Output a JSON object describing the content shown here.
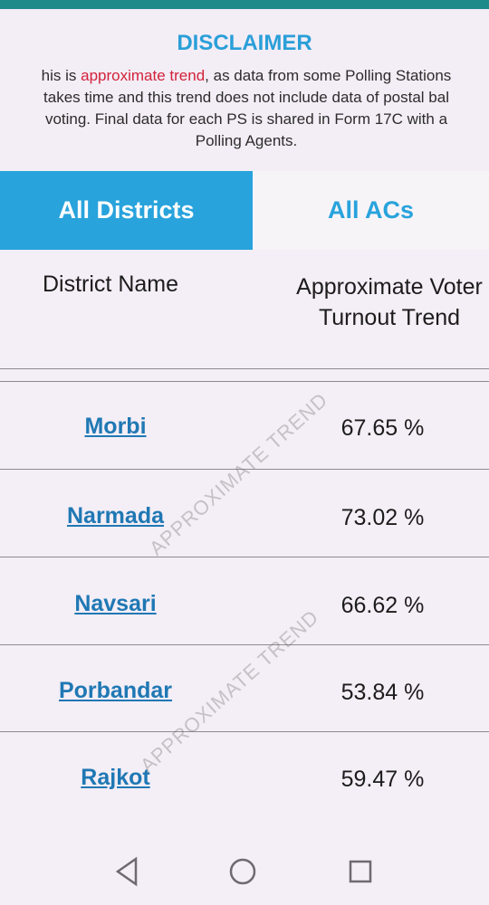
{
  "disclaimer": {
    "title": "DISCLAIMER",
    "line1_pre": "his is ",
    "line1_highlight": "approximate trend",
    "line1_post": ", as data from some Polling Stations",
    "line2": "takes time and this trend does not include data of postal bal",
    "line3": "voting. Final data for each PS is shared in Form 17C with a",
    "line4": "Polling Agents."
  },
  "tabs": [
    {
      "label": "All Districts",
      "active": true
    },
    {
      "label": "All ACs",
      "active": false
    }
  ],
  "table": {
    "headers": {
      "district": "District Name",
      "trend_line1": "Approximate Voter",
      "trend_line2": "Turnout Trend"
    },
    "rows": [
      {
        "district": "Morbi",
        "turnout": "67.65 %"
      },
      {
        "district": "Narmada",
        "turnout": "73.02 %"
      },
      {
        "district": "Navsari",
        "turnout": "66.62 %"
      },
      {
        "district": "Porbandar",
        "turnout": "53.84 %"
      },
      {
        "district": "Rajkot",
        "turnout": "59.47 %"
      }
    ]
  },
  "watermark": "APPROXIMATE TREND",
  "colors": {
    "accent": "#28a3dc",
    "link": "#1f78b4",
    "highlight": "#d2233a",
    "background": "#f4eef6"
  },
  "navbar": {
    "icons": [
      "back-triangle-icon",
      "home-circle-icon",
      "recents-square-icon"
    ]
  }
}
